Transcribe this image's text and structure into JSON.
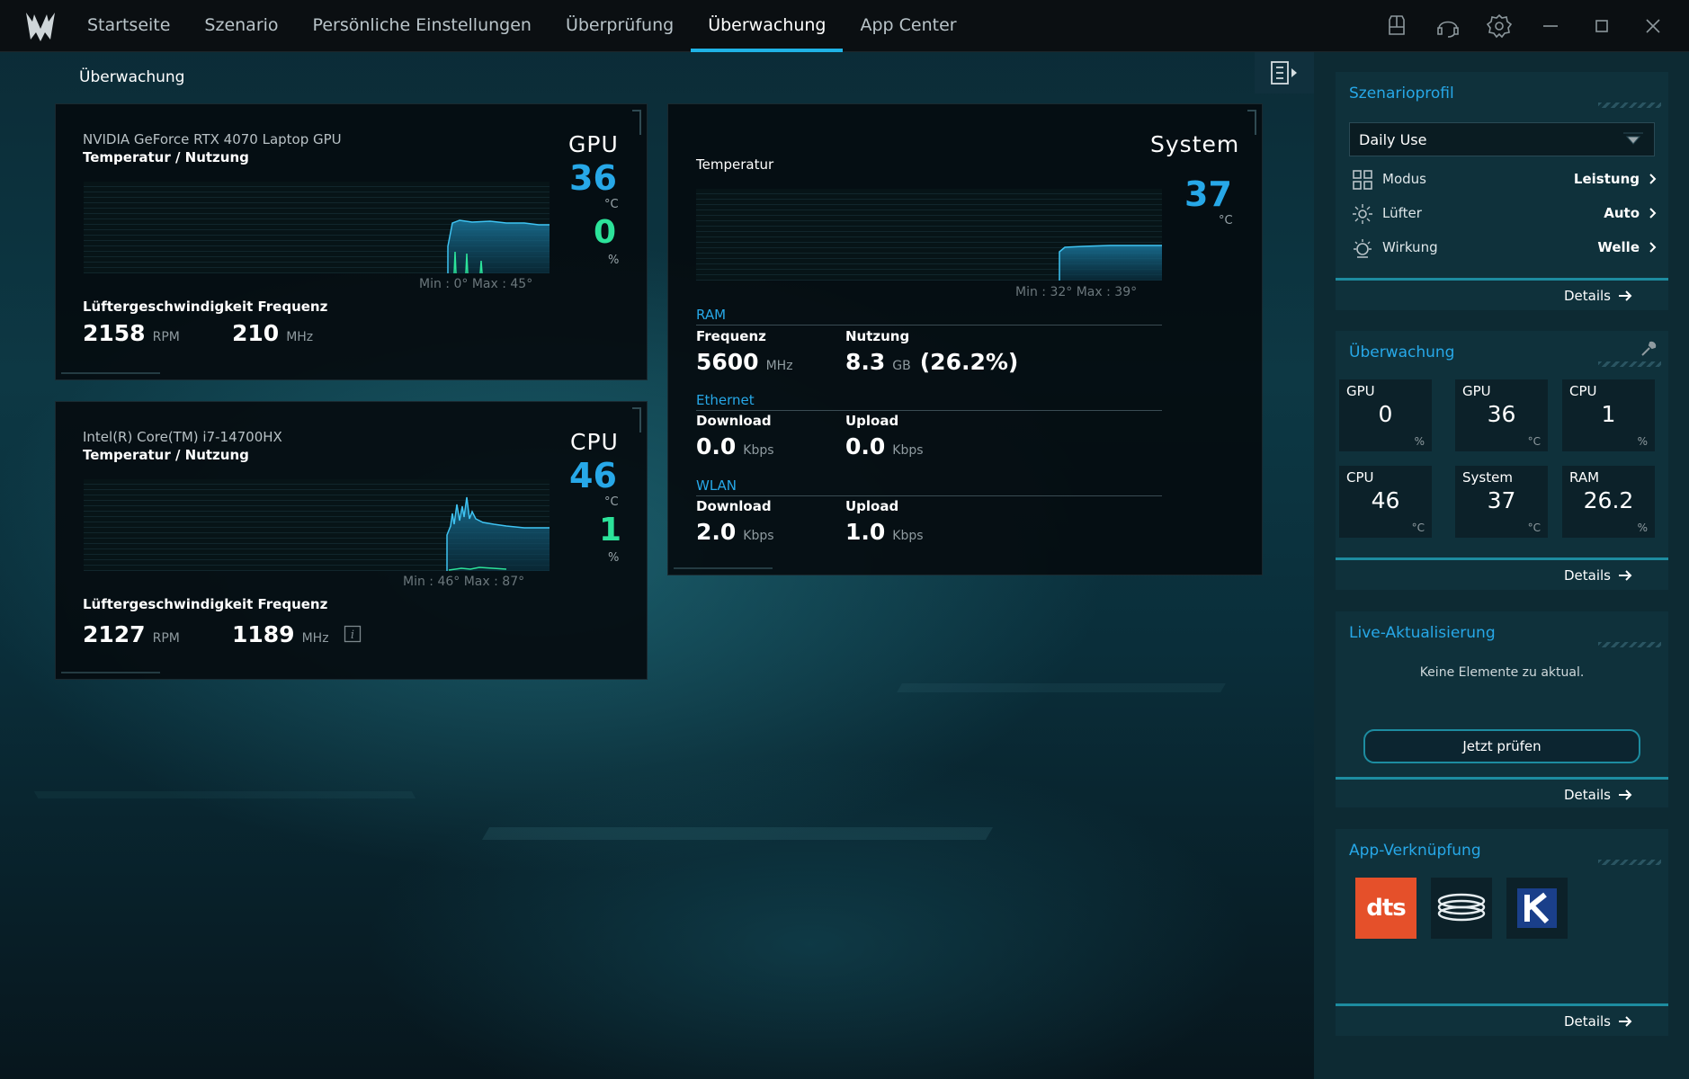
{
  "nav": {
    "items": [
      "Startseite",
      "Szenario",
      "Persönliche Einstellungen",
      "Überprüfung",
      "Überwachung",
      "App Center"
    ],
    "active_index": 4
  },
  "window_controls": [
    "keyboard-icon",
    "headset-icon",
    "settings-icon",
    "minimize-icon",
    "maximize-icon",
    "close-icon"
  ],
  "page_title": "Überwachung",
  "gpu": {
    "device": "NVIDIA GeForce RTX 4070 Laptop GPU",
    "subtitle": "Temperatur / Nutzung",
    "label": "GPU",
    "temp": "36",
    "temp_unit": "°C",
    "usage": "0",
    "usage_unit": "%",
    "minmax": "Min : 0°      Max : 45°",
    "fan_freq_label": "Lüftergeschwindigkeit Frequenz",
    "fan": "2158",
    "fan_unit": "RPM",
    "freq": "210",
    "freq_unit": "MHz"
  },
  "cpu": {
    "device": "Intel(R) Core(TM) i7-14700HX",
    "subtitle": "Temperatur / Nutzung",
    "label": "CPU",
    "temp": "46",
    "temp_unit": "°C",
    "usage": "1",
    "usage_unit": "%",
    "minmax": "Min : 46°      Max : 87°",
    "fan_freq_label": "Lüftergeschwindigkeit Frequenz",
    "fan": "2127",
    "fan_unit": "RPM",
    "freq": "1189",
    "freq_unit": "MHz"
  },
  "system": {
    "label": "System",
    "temp_label": "Temperatur",
    "temp": "37",
    "temp_unit": "°C",
    "minmax": "Min : 32°      Max : 39°",
    "ram": {
      "title": "RAM",
      "freq_label": "Frequenz",
      "freq": "5600",
      "freq_unit": "MHz",
      "usage_label": "Nutzung",
      "usage": "8.3",
      "usage_unit": "GB",
      "usage_pct": "(26.2%)"
    },
    "ethernet": {
      "title": "Ethernet",
      "down_label": "Download",
      "down": "0.0",
      "down_unit": "Kbps",
      "up_label": "Upload",
      "up": "0.0",
      "up_unit": "Kbps"
    },
    "wlan": {
      "title": "WLAN",
      "down_label": "Download",
      "down": "2.0",
      "down_unit": "Kbps",
      "up_label": "Upload",
      "up": "1.0",
      "up_unit": "Kbps"
    }
  },
  "sidebar": {
    "profile": {
      "title": "Szenarioprofil",
      "selected": "Daily Use",
      "rows": [
        {
          "label": "Modus",
          "value": "Leistung",
          "icon": "grid-icon"
        },
        {
          "label": "Lüfter",
          "value": "Auto",
          "icon": "fan-icon"
        },
        {
          "label": "Wirkung",
          "value": "Welle",
          "icon": "sun-icon"
        }
      ],
      "details": "Details"
    },
    "monitor": {
      "title": "Überwachung",
      "tiles": [
        {
          "label": "GPU",
          "value": "0",
          "unit": "%"
        },
        {
          "label": "GPU",
          "value": "36",
          "unit": "°C"
        },
        {
          "label": "CPU",
          "value": "1",
          "unit": "%"
        },
        {
          "label": "CPU",
          "value": "46",
          "unit": "°C"
        },
        {
          "label": "System",
          "value": "37",
          "unit": "°C"
        },
        {
          "label": "RAM",
          "value": "26.2",
          "unit": "%"
        }
      ],
      "details": "Details"
    },
    "live": {
      "title": "Live-Aktualisierung",
      "message": "Keine Elemente zu aktual.",
      "button": "Jetzt prüfen",
      "details": "Details"
    },
    "apps": {
      "title": "App-Verknüpfung",
      "items": [
        "dts"
      ],
      "details": "Details"
    }
  }
}
